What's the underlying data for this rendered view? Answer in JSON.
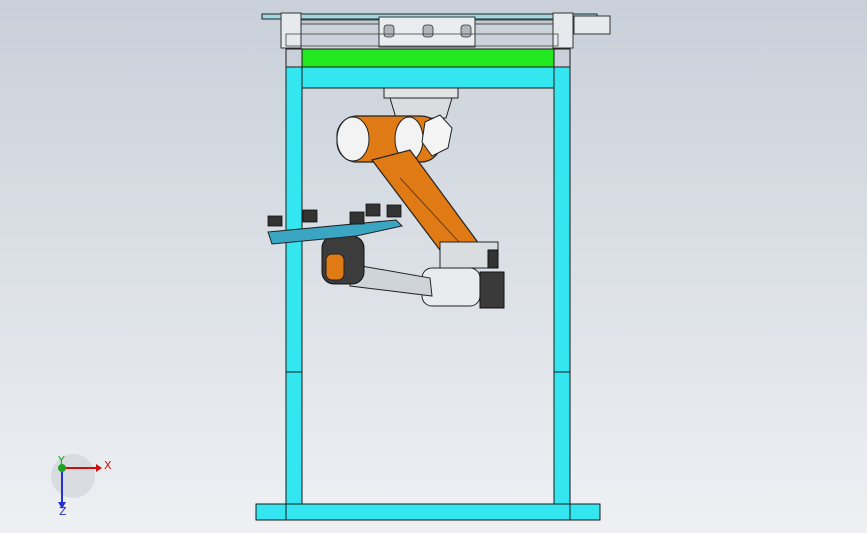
{
  "viewport": {
    "background_top": "#c9d0d9",
    "background_bottom": "#eef0f3"
  },
  "model": {
    "frame_color": "#33e6ef",
    "frame_edge_color": "#1a1a1a",
    "top_plate_color": "#22e81f",
    "robot_link_color": "#e07a14",
    "robot_joint_color": "#f5f5f5",
    "tray_color": "#3aa6c4"
  },
  "triad": {
    "x_label": "X",
    "y_label": "Y",
    "z_label": "Z",
    "x_color": "#d01010",
    "y_color": "#1aa51a",
    "z_color": "#2233cc"
  }
}
